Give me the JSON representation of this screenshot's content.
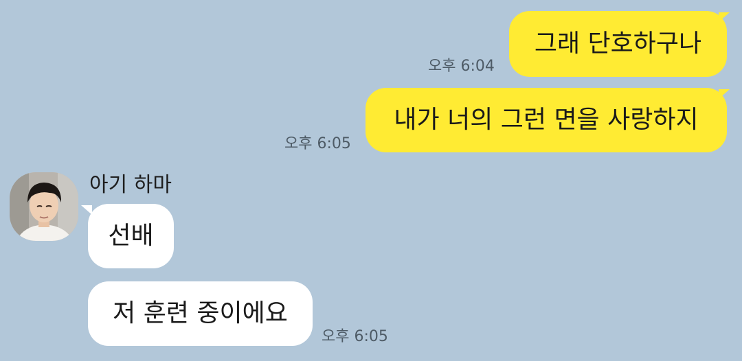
{
  "messages": [
    {
      "side": "mine",
      "text": "그래 단호하구나",
      "time": "오후 6:04"
    },
    {
      "side": "mine",
      "text": "내가 너의 그런 면을 사랑하지",
      "time": "오후 6:05"
    },
    {
      "side": "theirs",
      "text": "선배"
    },
    {
      "side": "theirs",
      "text": "저 훈련 중이에요",
      "time": "오후 6:05"
    }
  ],
  "sender": {
    "name": "아기 하마",
    "avatar_icon": "profile-photo-avatar"
  },
  "colors": {
    "background": "#b2c7d9",
    "my_bubble": "#ffeb33",
    "their_bubble": "#ffffff",
    "timestamp": "#4e5b66"
  }
}
